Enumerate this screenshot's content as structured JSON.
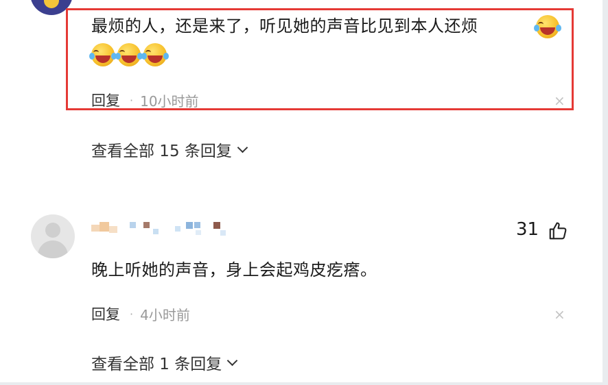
{
  "comment1": {
    "text": "最烦的人，还是来了，听见她的声音比见到本人还烦",
    "emoji_name": "crying-laughing-emoji",
    "reply_label": "回复",
    "separator": "·",
    "time": "10小时前",
    "close_icon": "close-icon",
    "view_all_replies": "查看全部 15 条回复"
  },
  "comment2": {
    "text": "晚上听她的声音，身上会起鸡皮疙瘩。",
    "like_count": "31",
    "like_icon": "thumbs-up-icon",
    "reply_label": "回复",
    "separator": "·",
    "time": "4小时前",
    "close_icon": "close-icon",
    "view_all_replies": "查看全部 1 条回复"
  },
  "colors": {
    "highlight_border": "#e53935",
    "secondary_text": "#999999"
  }
}
